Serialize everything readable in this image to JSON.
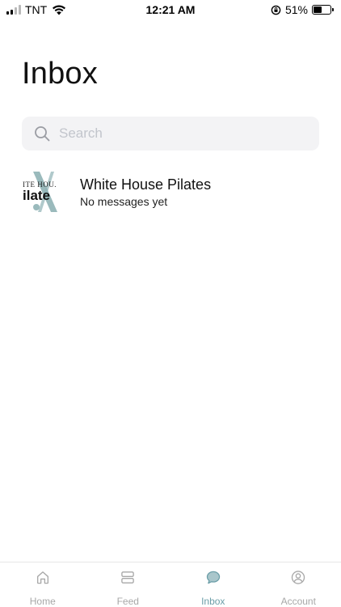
{
  "status_bar": {
    "carrier": "TNT",
    "time": "12:21 AM",
    "battery_percent": "51%",
    "battery_level": 0.51
  },
  "page": {
    "title": "Inbox"
  },
  "search": {
    "placeholder": "Search",
    "value": ""
  },
  "conversations": [
    {
      "name": "White House Pilates",
      "preview": "No messages yet",
      "avatar_logo_text": "ITE HOU. ilate"
    }
  ],
  "nav": {
    "items": [
      {
        "label": "Home",
        "icon": "home-icon",
        "active": false
      },
      {
        "label": "Feed",
        "icon": "feed-icon",
        "active": false
      },
      {
        "label": "Inbox",
        "icon": "chat-icon",
        "active": true
      },
      {
        "label": "Account",
        "icon": "account-icon",
        "active": false
      }
    ]
  },
  "colors": {
    "accent": "#6b9ea8",
    "inactive": "#a8a8a8",
    "search_bg": "#f3f3f5"
  }
}
